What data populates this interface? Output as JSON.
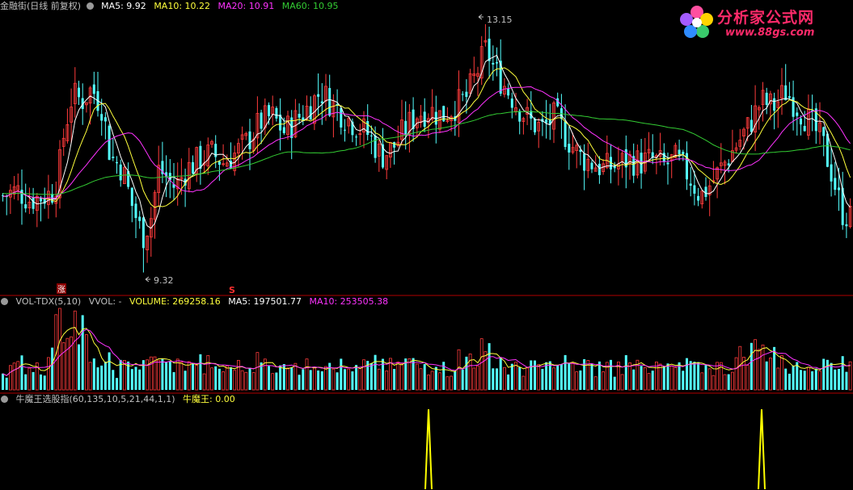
{
  "colors": {
    "up": "#ff3b3b",
    "down": "#54ffff",
    "ma5": "#ffffff",
    "ma10": "#ffff3c",
    "ma20": "#ff33ff",
    "ma60": "#33cc33",
    "axis": "#b00000",
    "text": "#c0c0c0"
  },
  "price_panel": {
    "title": "金融街(日线 前复权)",
    "ma5_label": "MA5: 9.92",
    "ma10_label": "MA10: 10.22",
    "ma20_label": "MA20: 10.91",
    "ma60_label": "MA60: 10.95",
    "high_marker": "13.15",
    "low_marker": "9.32",
    "badge_zhang": "涨",
    "badge_s": "S"
  },
  "volume_panel": {
    "label": "VOL-TDX(5,10)",
    "vvol_label": "VVOL: -",
    "volume_label": "VOLUME: 269258.16",
    "ma5_label": "MA5: 197501.77",
    "ma10_label": "MA10: 253505.38"
  },
  "indicator_panel": {
    "label": "牛魔王选股指(60,135,10,5,21,44,1,1)",
    "value_label": "牛魔王: 0.00"
  },
  "logo": {
    "text": "分析家公式网",
    "url": "www.88gs.com"
  },
  "chart_data": [
    {
      "type": "candlestick",
      "title": "金融街(日线 前复权)",
      "y_range": [
        9.0,
        13.5
      ],
      "annotations": [
        {
          "label": "13.15",
          "value": 13.15,
          "kind": "high"
        },
        {
          "label": "9.32",
          "value": 9.32,
          "kind": "low"
        }
      ],
      "close_points": [
        [
          0,
          10.55
        ],
        [
          10,
          10.6
        ],
        [
          20,
          10.65
        ],
        [
          35,
          10.5
        ],
        [
          50,
          10.55
        ],
        [
          62,
          10.6
        ],
        [
          70,
          10.85
        ],
        [
          78,
          11.6
        ],
        [
          88,
          12.2
        ],
        [
          100,
          12.1
        ],
        [
          112,
          12.3
        ],
        [
          125,
          12.0
        ],
        [
          135,
          11.2
        ],
        [
          150,
          11.0
        ],
        [
          162,
          10.4
        ],
        [
          175,
          9.9
        ],
        [
          185,
          10.2
        ],
        [
          195,
          11.0
        ],
        [
          205,
          10.85
        ],
        [
          215,
          10.7
        ],
        [
          230,
          11.0
        ],
        [
          245,
          11.15
        ],
        [
          260,
          11.25
        ],
        [
          275,
          11.1
        ],
        [
          290,
          11.25
        ],
        [
          305,
          11.45
        ],
        [
          320,
          11.75
        ],
        [
          335,
          11.85
        ],
        [
          350,
          11.6
        ],
        [
          365,
          11.8
        ],
        [
          380,
          12.0
        ],
        [
          395,
          12.25
        ],
        [
          410,
          12.05
        ],
        [
          425,
          11.85
        ],
        [
          440,
          11.7
        ],
        [
          455,
          11.55
        ],
        [
          470,
          11.2
        ],
        [
          485,
          11.35
        ],
        [
          500,
          11.65
        ],
        [
          515,
          11.9
        ],
        [
          530,
          11.95
        ],
        [
          545,
          11.85
        ],
        [
          560,
          12.0
        ],
        [
          575,
          12.15
        ],
        [
          588,
          12.55
        ],
        [
          600,
          12.95
        ],
        [
          610,
          12.6
        ],
        [
          625,
          12.3
        ],
        [
          640,
          12.0
        ],
        [
          655,
          11.75
        ],
        [
          670,
          11.65
        ],
        [
          685,
          11.85
        ],
        [
          700,
          11.5
        ],
        [
          715,
          11.2
        ],
        [
          730,
          11.1
        ],
        [
          745,
          11.0
        ],
        [
          760,
          11.05
        ],
        [
          775,
          11.15
        ],
        [
          790,
          11.1
        ],
        [
          805,
          11.15
        ],
        [
          820,
          11.05
        ],
        [
          835,
          11.15
        ],
        [
          850,
          10.9
        ],
        [
          865,
          10.55
        ],
        [
          880,
          10.8
        ],
        [
          895,
          11.1
        ],
        [
          910,
          11.4
        ],
        [
          925,
          11.7
        ],
        [
          940,
          12.1
        ],
        [
          955,
          12.0
        ],
        [
          970,
          12.25
        ],
        [
          985,
          12.0
        ],
        [
          1000,
          11.75
        ],
        [
          1015,
          11.45
        ],
        [
          1028,
          10.9
        ],
        [
          1040,
          10.3
        ],
        [
          1055,
          10.15
        ]
      ]
    },
    {
      "type": "bar",
      "title": "VOL-TDX(5,10)",
      "series": [
        {
          "name": "VOLUME",
          "value": 269258.16
        },
        {
          "name": "MA5",
          "value": 197501.77
        },
        {
          "name": "MA10",
          "value": 253505.38
        }
      ]
    },
    {
      "type": "line",
      "title": "牛魔王选股指(60,135,10,5,21,44,1,1)",
      "series": [
        {
          "name": "牛魔王",
          "value": 0.0
        }
      ],
      "signals_x": [
        530,
        942
      ]
    }
  ]
}
